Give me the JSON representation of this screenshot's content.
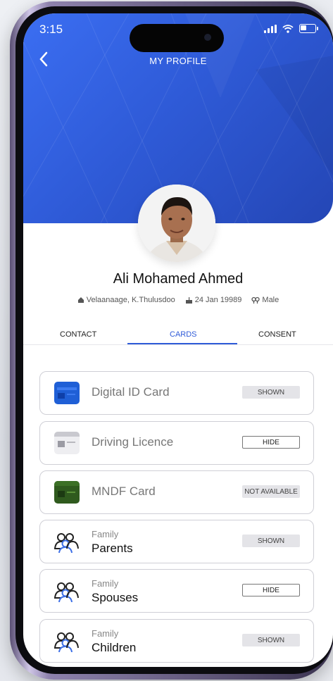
{
  "status_bar": {
    "time": "3:15"
  },
  "header": {
    "title": "MY PROFILE"
  },
  "profile": {
    "name": "Ali Mohamed Ahmed",
    "address": "Velaanaage, K.Thulusdoo",
    "dob": "24 Jan 19989",
    "gender": "Male"
  },
  "tabs": [
    {
      "label": "CONTACT"
    },
    {
      "label": "CARDS"
    },
    {
      "label": "CONSENT"
    }
  ],
  "active_tab": "CARDS",
  "cards": [
    {
      "label": "Digital ID Card",
      "status": "SHOWN"
    },
    {
      "label": "Driving Licence",
      "status": "HIDE"
    },
    {
      "label": "MNDF Card",
      "status": "NOT AVAILABLE"
    }
  ],
  "family": [
    {
      "small": "Family",
      "label": "Parents",
      "status": "SHOWN"
    },
    {
      "small": "Family",
      "label": "Spouses",
      "status": "HIDE"
    },
    {
      "small": "Family",
      "label": "Children",
      "status": "SHOWN"
    }
  ],
  "colors": {
    "accent": "#2f5bd8",
    "header_gradient_start": "#3b6ef2",
    "header_gradient_end": "#2446b5"
  }
}
